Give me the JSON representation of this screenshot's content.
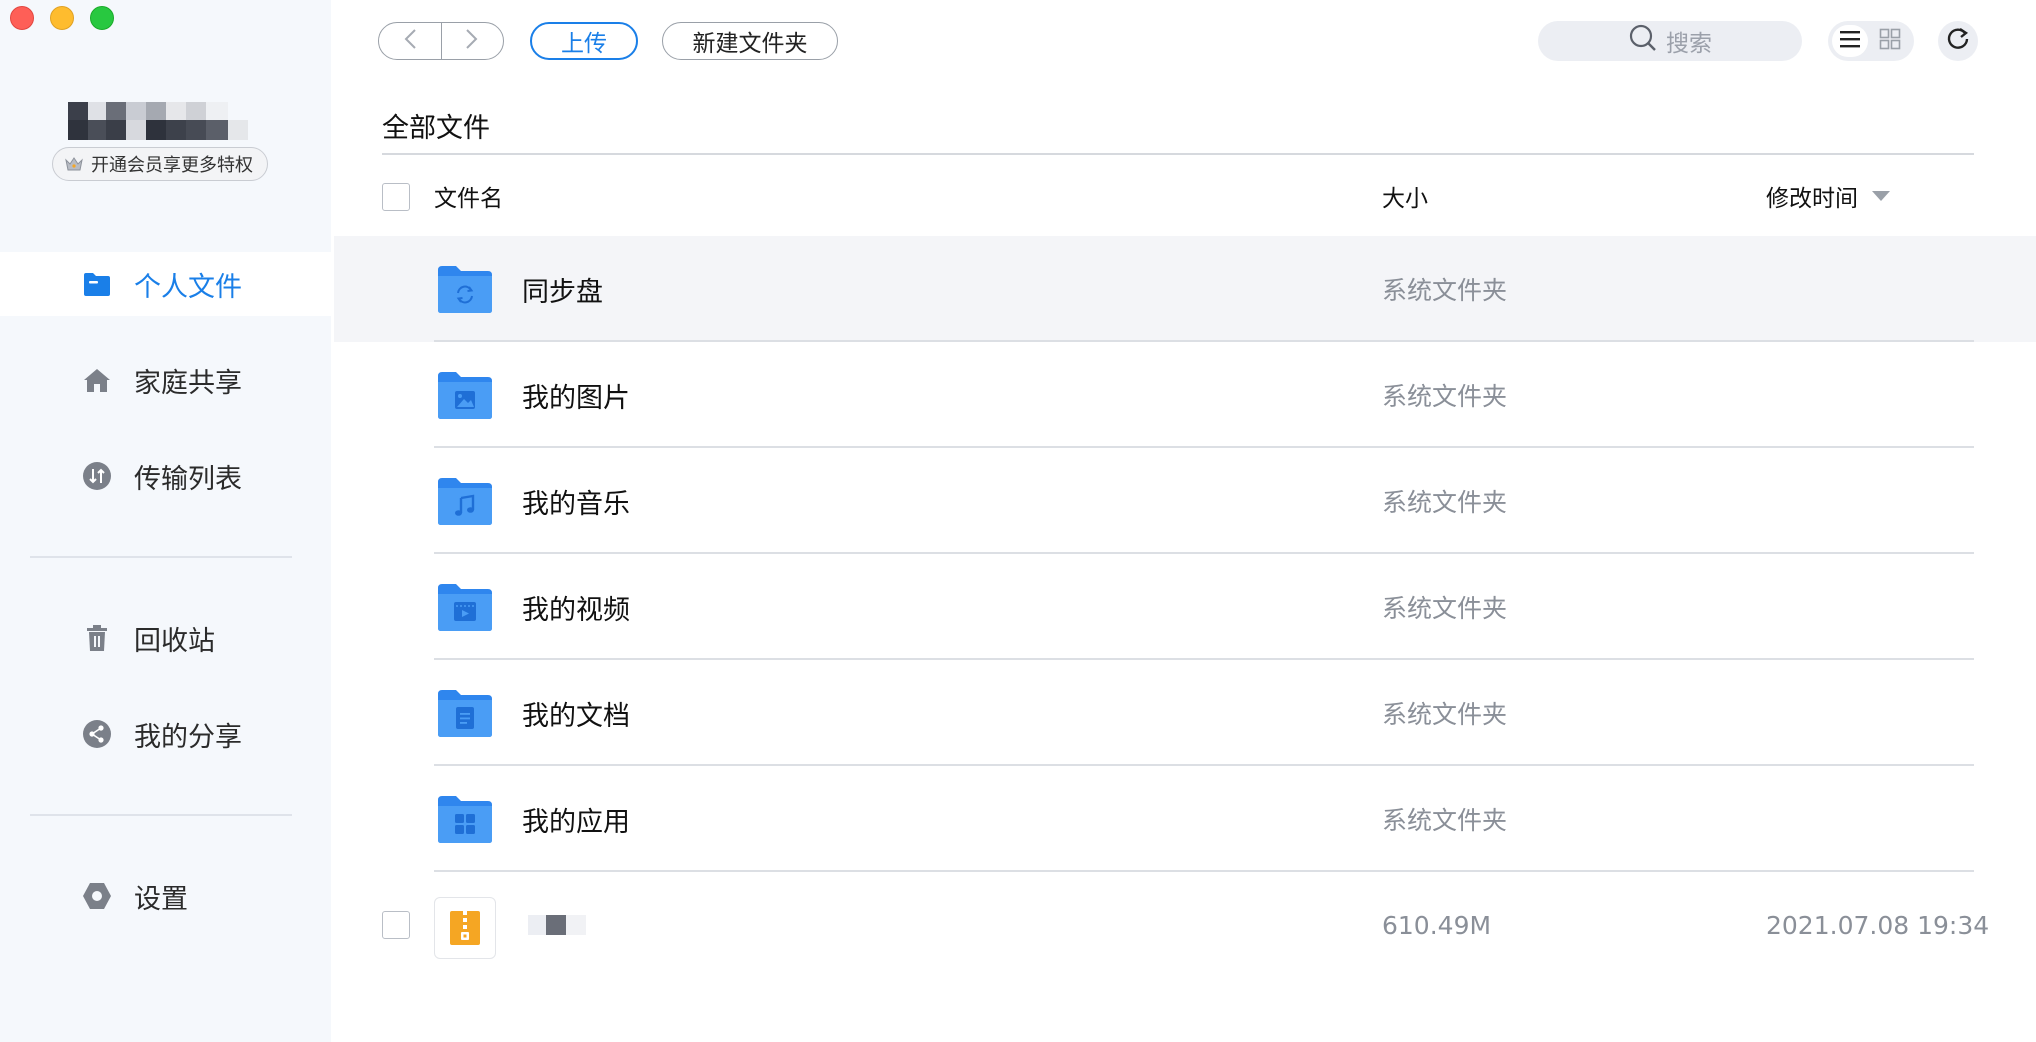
{
  "sidebar": {
    "vip_label": "开通会员享更多特权",
    "items": [
      {
        "label": "个人文件",
        "icon": "folder-icon"
      },
      {
        "label": "家庭共享",
        "icon": "home-icon"
      },
      {
        "label": "传输列表",
        "icon": "transfer-icon"
      },
      {
        "label": "回收站",
        "icon": "trash-icon"
      },
      {
        "label": "我的分享",
        "icon": "share-icon"
      },
      {
        "label": "设置",
        "icon": "settings-icon"
      }
    ]
  },
  "toolbar": {
    "upload_label": "上传",
    "new_folder_label": "新建文件夹",
    "search_placeholder": "搜索"
  },
  "breadcrumb": "全部文件",
  "columns": {
    "name": "文件名",
    "size": "大小",
    "modified": "修改时间"
  },
  "rows": [
    {
      "name": "同步盘",
      "size": "系统文件夹",
      "modified": "",
      "icon": "sync-folder-icon"
    },
    {
      "name": "我的图片",
      "size": "系统文件夹",
      "modified": "",
      "icon": "image-folder-icon"
    },
    {
      "name": "我的音乐",
      "size": "系统文件夹",
      "modified": "",
      "icon": "music-folder-icon"
    },
    {
      "name": "我的视频",
      "size": "系统文件夹",
      "modified": "",
      "icon": "video-folder-icon"
    },
    {
      "name": "我的文档",
      "size": "系统文件夹",
      "modified": "",
      "icon": "document-folder-icon"
    },
    {
      "name": "我的应用",
      "size": "系统文件夹",
      "modified": "",
      "icon": "apps-folder-icon"
    }
  ],
  "file_row": {
    "size": "610.49M",
    "modified": "2021.07.08 19:34",
    "icon": "zip-file-icon"
  },
  "colors": {
    "accent": "#1a7fe8",
    "folder": "#4a9df5",
    "sidebar_bg": "#f5f8fc",
    "zip": "#f5a623"
  }
}
